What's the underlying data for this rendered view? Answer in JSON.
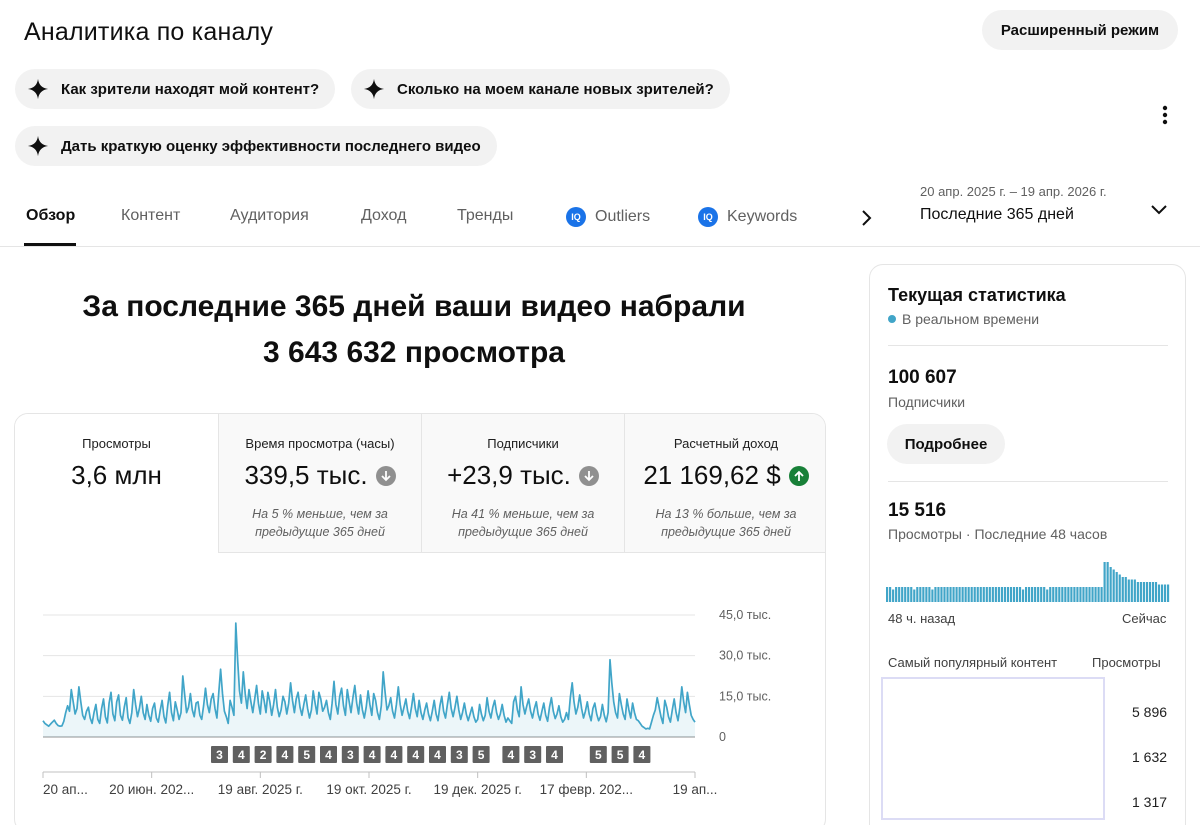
{
  "header": {
    "title": "Аналитика по каналу",
    "advanced_mode_label": "Расширенный режим"
  },
  "suggestions": [
    {
      "label": "Как зрители находят мой контент?"
    },
    {
      "label": "Сколько на моем канале новых зрителей?"
    },
    {
      "label": "Дать краткую оценку эффективности последнего видео"
    }
  ],
  "tabs": [
    {
      "label": "Обзор",
      "active": true
    },
    {
      "label": "Контент"
    },
    {
      "label": "Аудитория"
    },
    {
      "label": "Доход"
    },
    {
      "label": "Тренды"
    },
    {
      "label": "Outliers",
      "badge": "IQ"
    },
    {
      "label": "Keywords",
      "badge": "IQ"
    }
  ],
  "date_picker": {
    "range": "20 апр. 2025 г. – 19 апр. 2026 г.",
    "label": "Последние 365 дней"
  },
  "headline": {
    "line1": "За последние 365 дней ваши видео набрали",
    "line2": "3 643 632 просмотра"
  },
  "metrics": [
    {
      "label": "Просмотры",
      "value": "3,6 млн",
      "trend": null,
      "note": ""
    },
    {
      "label": "Время просмотра (часы)",
      "value": "339,5 тыс.",
      "trend": "down",
      "note": "На 5 % меньше, чем за предыдущие 365 дней"
    },
    {
      "label": "Подписчики",
      "value": "+23,9 тыс.",
      "trend": "down",
      "note": "На 41 % меньше, чем за предыдущие 365 дней"
    },
    {
      "label": "Расчетный доход",
      "value": "21 169,62 $",
      "trend": "up",
      "note": "На 13 % больше, чем за предыдущие 365 дней"
    }
  ],
  "chart_data": {
    "type": "area",
    "title": "",
    "xlabel": "",
    "ylabel": "",
    "y_ticks": [
      "45,0 тыс.",
      "30,0 тыс.",
      "15,0 тыс.",
      "0"
    ],
    "ylim": [
      0,
      45000
    ],
    "x_tick_labels": [
      "20 ап...",
      "20 июн. 202...",
      "19 авг. 2025 г.",
      "19 окт. 2025 г.",
      "19 дек. 2025 г.",
      "17 февр. 202...",
      "19 ап..."
    ],
    "series": [
      {
        "color": "#41a5c8",
        "values": [
          6000,
          5000,
          4500,
          4000,
          4800,
          5500,
          6200,
          5000,
          4200,
          4000,
          4100,
          5800,
          9000,
          11500,
          9500,
          17500,
          13000,
          8500,
          10500,
          18500,
          13000,
          8000,
          6500,
          9500,
          11000,
          7000,
          5000,
          9000,
          12000,
          6500,
          5000,
          10500,
          14000,
          7500,
          5200,
          12500,
          16500,
          8500,
          6000,
          13000,
          15500,
          8000,
          6200,
          11000,
          14500,
          7200,
          5000,
          9000,
          17500,
          12000,
          7500,
          10500,
          15000,
          9000,
          6500,
          12000,
          8000,
          5800,
          10500,
          12500,
          7000,
          5500,
          9800,
          13500,
          7500,
          5200,
          11500,
          16500,
          9000,
          6000,
          13000,
          10000,
          6500,
          9000,
          22500,
          15500,
          9000,
          11000,
          16000,
          10000,
          7500,
          12500,
          13000,
          8000,
          6500,
          11500,
          18000,
          12000,
          9000,
          14000,
          16000,
          10500,
          7000,
          16500,
          25000,
          16000,
          9500,
          7500,
          5000,
          13500,
          11000,
          8000,
          42000,
          28000,
          17000,
          12500,
          24000,
          16000,
          10500,
          17500,
          13000,
          9000,
          14000,
          19000,
          12500,
          8500,
          17000,
          13500,
          9000,
          16500,
          13000,
          8000,
          12000,
          17500,
          11000,
          7500,
          10000,
          15000,
          13000,
          8500,
          12500,
          20000,
          13500,
          9000,
          14000,
          16500,
          11000,
          8000,
          12000,
          15500,
          10500,
          7000,
          10000,
          17000,
          12500,
          8500,
          16500,
          14000,
          9500,
          11000,
          13500,
          9000,
          6500,
          12500,
          20500,
          12000,
          8500,
          15000,
          18000,
          11500,
          8000,
          17500,
          13000,
          9000,
          14500,
          19000,
          12500,
          8500,
          15500,
          10000,
          7000,
          11000,
          17000,
          12000,
          8000,
          16000,
          13500,
          9000,
          6500,
          11500,
          24000,
          16500,
          10000,
          11500,
          14500,
          9500,
          7000,
          12000,
          18500,
          12000,
          8000,
          11000,
          14000,
          9500,
          6800,
          11000,
          16000,
          10500,
          7500,
          13500,
          9000,
          6500,
          10000,
          12500,
          8500,
          6000,
          9500,
          13500,
          8500,
          6000,
          11500,
          15000,
          9500,
          7000,
          12000,
          16500,
          10500,
          7500,
          11000,
          15000,
          10000,
          6500,
          9000,
          12500,
          8500,
          6000,
          8500,
          11000,
          7500,
          5500,
          6500,
          12000,
          8500,
          6000,
          8000,
          14500,
          9500,
          7000,
          11000,
          13500,
          9000,
          6500,
          8500,
          12000,
          8000,
          5500,
          7000,
          6000,
          5000,
          13000,
          15000,
          10000,
          7500,
          18500,
          12000,
          8500,
          11500,
          14000,
          9500,
          7000,
          10500,
          13000,
          8500,
          6200,
          9500,
          12500,
          8000,
          5800,
          11000,
          14500,
          9500,
          6800,
          8500,
          11500,
          7500,
          5500,
          6500,
          9000,
          6500,
          14500,
          20000,
          13000,
          8500,
          11000,
          15500,
          10500,
          7000,
          9500,
          13000,
          8500,
          6000,
          10500,
          12500,
          8500,
          6000,
          7500,
          12000,
          8000,
          5600,
          9000,
          28500,
          20000,
          13000,
          9000,
          7000,
          16000,
          12000,
          8500,
          6500,
          14000,
          10000,
          7000,
          12500,
          9000,
          6500,
          6000,
          5000,
          4000,
          3500,
          3000,
          3200,
          3000,
          5500,
          8000,
          10000,
          14500,
          11000,
          7500,
          5000,
          13500,
          11000,
          7500,
          5500,
          10000,
          14000,
          9000,
          6000,
          11000,
          18500,
          13000,
          9000,
          16500,
          12000,
          8000,
          6500,
          5500
        ]
      }
    ],
    "event_markers": [
      "3",
      "4",
      "2",
      "4",
      "5",
      "4",
      "3",
      "4",
      "4",
      "4",
      "4",
      "3",
      "5",
      "4",
      "3",
      "4",
      "5",
      "5",
      "4"
    ]
  },
  "realtime": {
    "title": "Текущая статистика",
    "live_label": "В реальном времени",
    "subscribers_value": "100 607",
    "subscribers_label": "Подписчики",
    "details_label": "Подробнее",
    "views_value": "15 516",
    "views_label": "Просмотры · Последние 48 часов",
    "mini_chart": {
      "type": "bar",
      "color": "#41a5c8",
      "values": [
        3,
        3,
        2.5,
        3,
        3,
        3,
        3,
        3,
        3,
        2.5,
        3,
        3,
        3,
        3,
        3,
        2.5,
        3,
        3,
        3,
        3,
        3,
        3,
        3,
        3,
        3,
        3,
        3,
        3,
        3,
        3,
        3,
        3,
        3,
        3,
        3,
        3,
        3,
        3,
        3,
        3,
        3,
        3,
        3,
        3,
        3,
        2.5,
        3,
        3,
        3,
        3,
        3,
        3,
        3,
        2.5,
        3,
        3,
        3,
        3,
        3,
        3,
        3,
        3,
        3,
        3,
        3,
        3,
        3,
        3,
        3,
        3,
        3,
        3,
        8,
        8,
        7,
        6.5,
        6,
        5.5,
        5,
        5,
        4.5,
        4.5,
        4.5,
        4,
        4,
        4,
        4,
        4,
        4,
        4,
        3.5,
        3.5,
        3.5,
        3.5
      ]
    },
    "mini_start_label": "48 ч. назад",
    "mini_end_label": "Сейчас",
    "popular_header": "Самый популярный контент",
    "popular_views_header": "Просмотры",
    "popular_values": [
      "5 896",
      "1 632",
      "1 317"
    ]
  }
}
